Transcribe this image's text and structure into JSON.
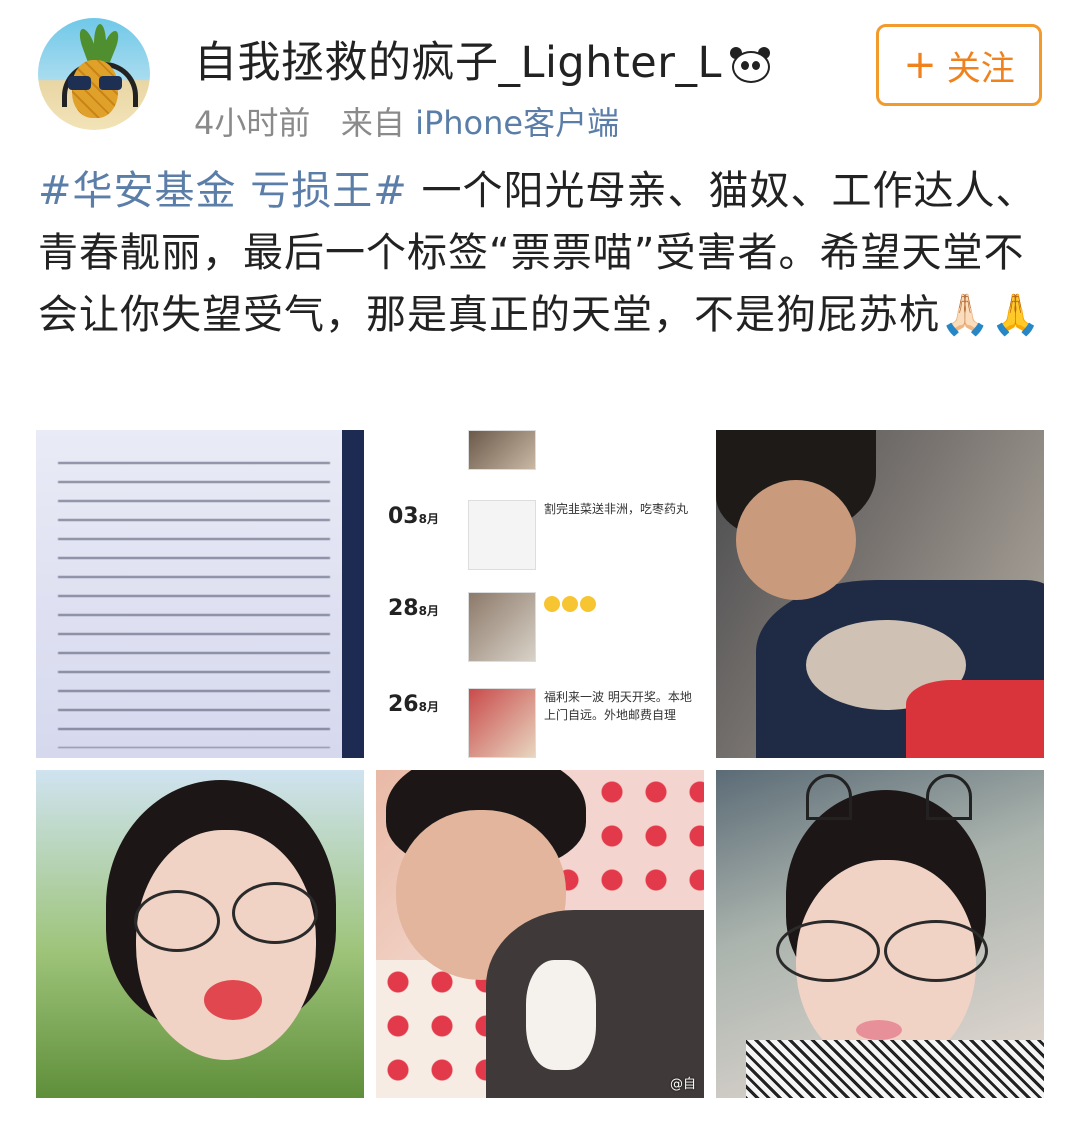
{
  "header": {
    "username": "自我拯救的疯子_Lighter_L",
    "time": "4小时前",
    "from_label": "来自",
    "source": "iPhone客户端",
    "follow_label": "关注",
    "follow_icon": "plus-icon",
    "badge_icon": "panda-icon",
    "avatar_icon": "pineapple-avatar"
  },
  "post": {
    "hashtag": "#华安基金 亏损王#",
    "text": " 一个阳光母亲、猫奴、工作达人、青春靓丽，最后一个标签“票票喵”受害者。希望天堂不会让你失望受气，那是真正的天堂，不是狗屁苏杭",
    "emoji": "🙏🏻🙏"
  },
  "images": {
    "feed": [
      {
        "day": "03",
        "unit": "8月",
        "text": "割完韭菜送非洲，吃枣药丸"
      },
      {
        "day": "28",
        "unit": "8月",
        "text": ""
      },
      {
        "day": "26",
        "unit": "8月",
        "text": "福利来一波 明天开奖。本地上门自远。外地邮费自理"
      }
    ],
    "watermark": "@自"
  },
  "colors": {
    "link": "#5b7ea8",
    "follow": "#f0821e",
    "meta": "#8a8a8a"
  }
}
